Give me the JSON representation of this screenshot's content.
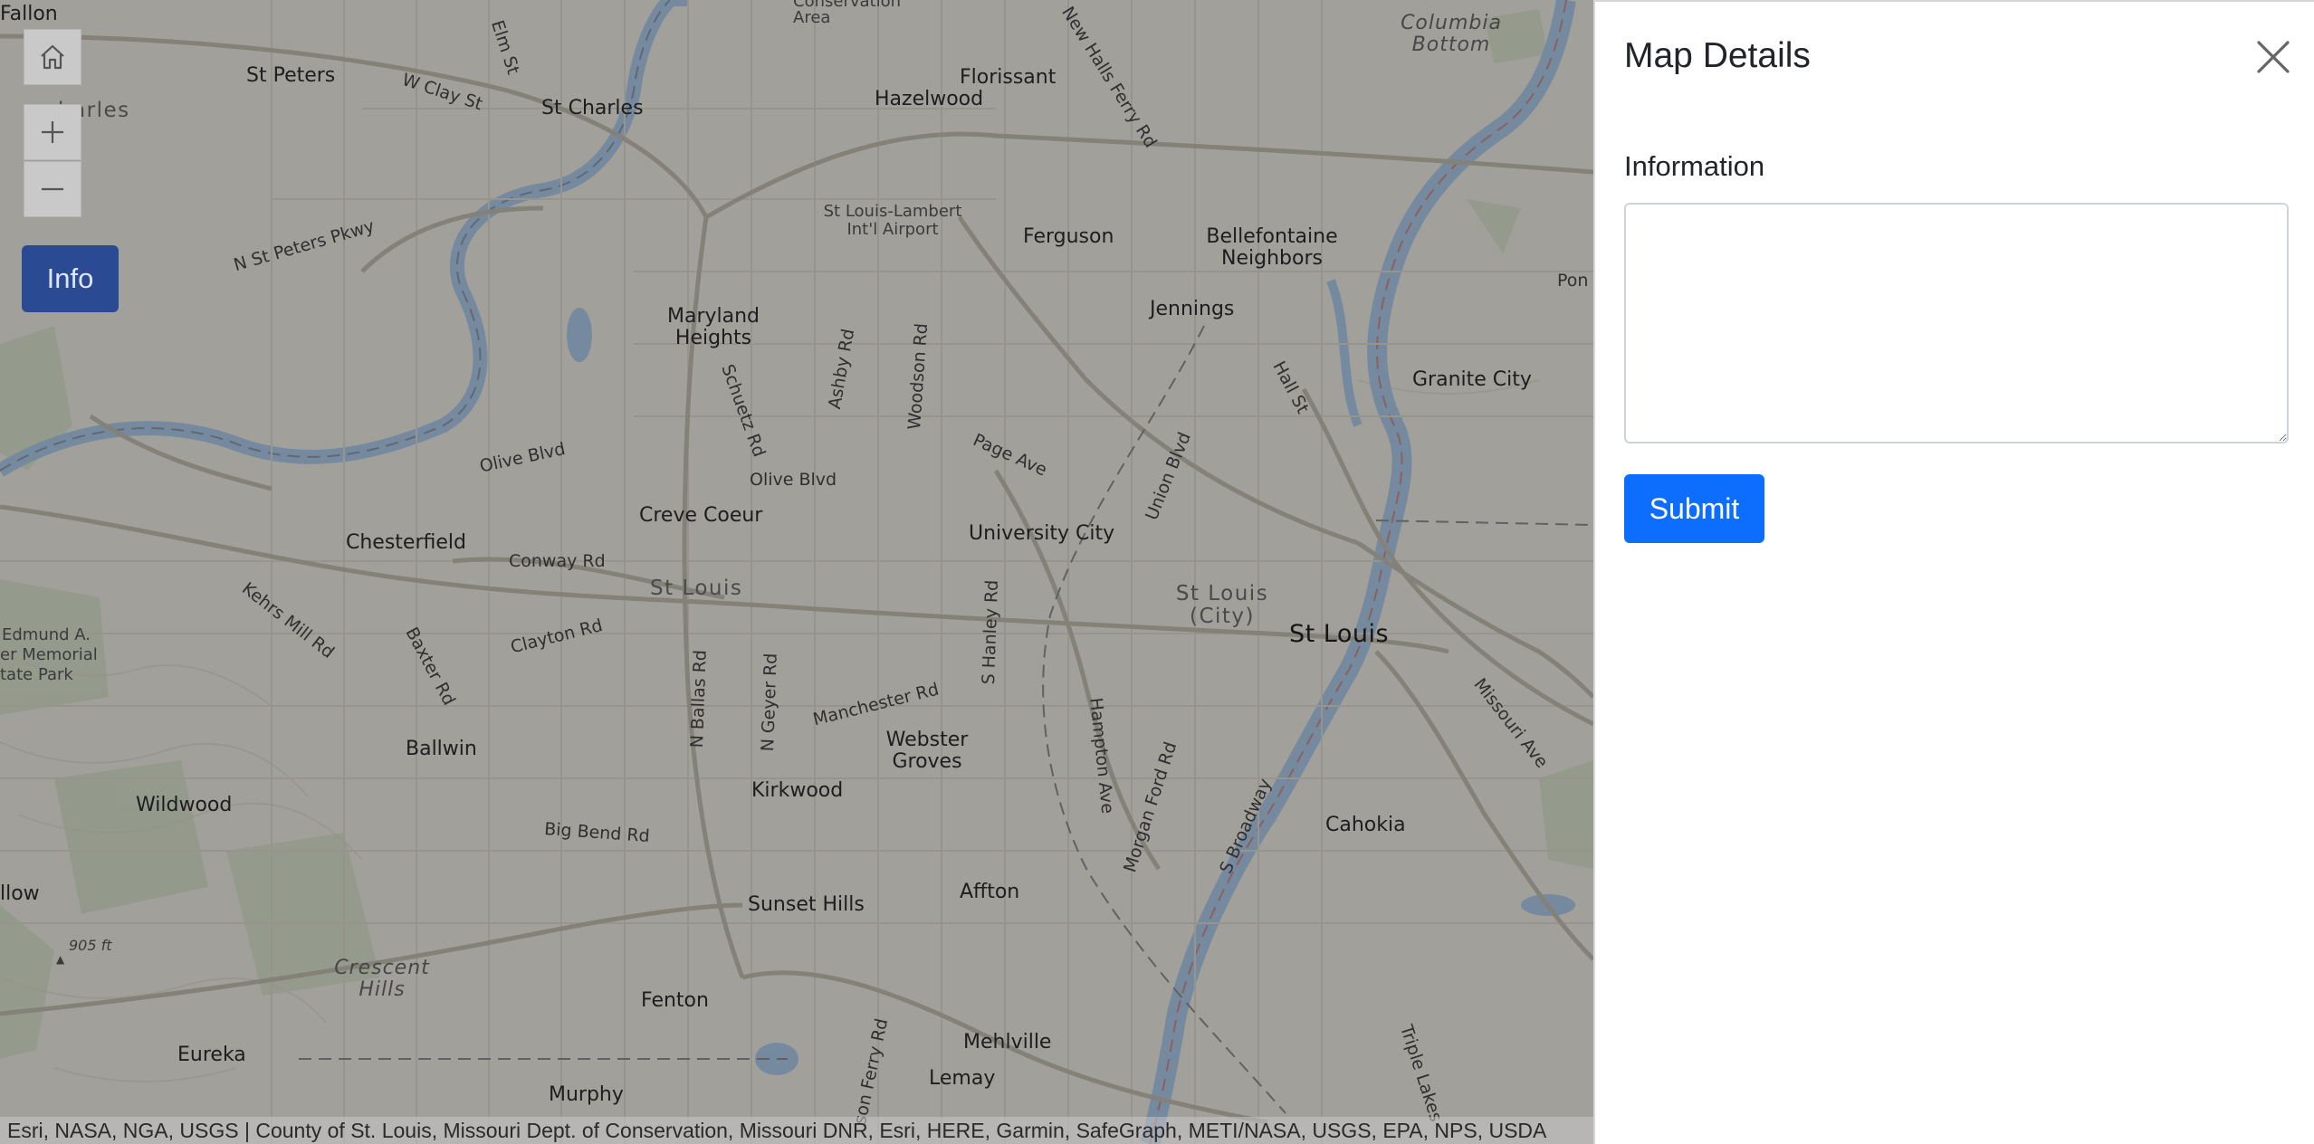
{
  "colors": {
    "accent": "#0d6efd",
    "info_button": "#2b4a94",
    "water": "#a9c6e4",
    "map_bg": "#e8e6df"
  },
  "icons": {
    "home": "home-icon",
    "zoom_in": "plus-icon",
    "zoom_out": "minus-icon",
    "close": "close-icon"
  },
  "map": {
    "info_button_label": "Info",
    "attribution": "Esri, NASA, NGA, USGS | County of St. Louis, Missouri Dept. of Conservation, Missouri DNR, Esri, HERE, Garmin, SafeGraph, METI/NASA, USGS, EPA, NPS, USDA",
    "labels": {
      "fallon": "Fallon",
      "elm_st": "Elm St",
      "conservation_area_top": "Conservation",
      "conservation_area": "Area",
      "new_halls_ferry": "New Halls Ferry Rd",
      "columbia_bottom": "Columbia Bottom",
      "st_peters": "St Peters",
      "w_clay_st": "W Clay St",
      "st_charles": "St Charles",
      "charles_frag": "harles",
      "florissant": "Florissant",
      "hazelwood": "Hazelwood",
      "airport": "St Louis-Lambert Int'l Airport",
      "ferguson": "Ferguson",
      "bellefontaine": "Bellefontaine Neighbors",
      "n_st_peters_pkwy": "N St Peters Pkwy",
      "jennings": "Jennings",
      "maryland_heights": "Maryland Heights",
      "ashby_rd": "Ashby Rd",
      "woodson_rd": "Woodson Rd",
      "schuetz_rd": "Schuetz Rd",
      "hall_st": "Hall St",
      "granite_city": "Granite City",
      "pon": "Pon",
      "page_ave": "Page Ave",
      "olive_blvd_w": "Olive Blvd",
      "olive_blvd_e": "Olive Blvd",
      "union_blvd": "Union Blvd",
      "creve_coeur": "Creve Coeur",
      "chesterfield": "Chesterfield",
      "university_city": "University City",
      "conway_rd": "Conway Rd",
      "st_louis_county": "St Louis",
      "st_louis_city": "St Louis (City)",
      "st_louis": "St Louis",
      "kehrs_mill_rd": "Kehrs Mill Rd",
      "baxter_rd": "Baxter Rd",
      "clayton_rd": "Clayton Rd",
      "n_ballas_rd": "N Ballas Rd",
      "n_geyer_rd": "N Geyer Rd",
      "s_hanley_rd": "S Hanley Rd",
      "missouri_ave": "Missouri Ave",
      "edmund_a": "Edmund A.",
      "memorial": "er Memorial",
      "state_park": "tate Park",
      "manchester_rd": "Manchester Rd",
      "hampton_ave": "Hampton Ave",
      "ballwin": "Ballwin",
      "webster_groves": "Webster Groves",
      "morgan_ford_rd": "Morgan Ford Rd",
      "kirkwood": "Kirkwood",
      "s_broadway": "S Broadway",
      "wildwood": "Wildwood",
      "cahokia": "Cahokia",
      "big_bend_rd": "Big Bend Rd",
      "llow": "llow",
      "sunset_hills": "Sunset Hills",
      "affton": "Affton",
      "elevation": "905 ft",
      "crescent_hills": "Crescent Hills",
      "fenton": "Fenton",
      "eureka": "Eureka",
      "mehlville": "Mehlville",
      "lemay": "Lemay",
      "lemay_ferry_rd": "son Ferry Rd",
      "murphy": "Murphy",
      "triple_lakes": "Triple Lakes"
    }
  },
  "panel": {
    "title": "Map Details",
    "field_label": "Information",
    "textarea_value": "",
    "submit_label": "Submit"
  }
}
